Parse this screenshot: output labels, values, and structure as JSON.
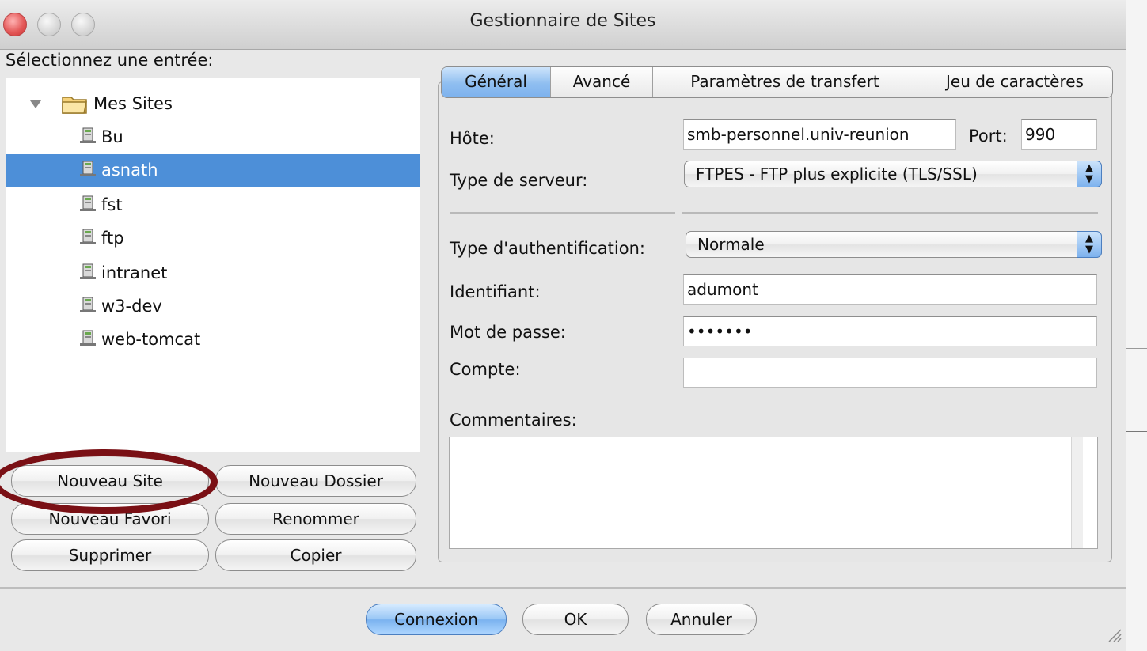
{
  "window": {
    "title": "Gestionnaire de Sites"
  },
  "left": {
    "select_label": "Sélectionnez une entrée:",
    "tree": {
      "root": "Mes Sites",
      "items": [
        "Bu",
        "asnath",
        "fst",
        "ftp",
        "intranet",
        "w3-dev",
        "web-tomcat"
      ],
      "selected": "asnath"
    },
    "buttons": {
      "new_site": "Nouveau Site",
      "new_folder": "Nouveau Dossier",
      "new_bookmark": "Nouveau Favori",
      "rename": "Renommer",
      "delete": "Supprimer",
      "copy": "Copier"
    }
  },
  "tabs": [
    {
      "label": "Général",
      "active": true
    },
    {
      "label": "Avancé",
      "active": false
    },
    {
      "label": "Paramètres de transfert",
      "active": false
    },
    {
      "label": "Jeu de caractères",
      "active": false
    }
  ],
  "general": {
    "host_label": "Hôte:",
    "host_value": "smb-personnel.univ-reunion",
    "port_label": "Port:",
    "port_value": "990",
    "server_type_label": "Type de serveur:",
    "server_type_value": "FTPES - FTP plus explicite (TLS/SSL)",
    "auth_type_label": "Type d'authentification:",
    "auth_type_value": "Normale",
    "user_label": "Identifiant:",
    "user_value": "adumont",
    "password_label": "Mot de passe:",
    "password_value": "•••••••",
    "account_label": "Compte:",
    "account_value": "",
    "comments_label": "Commentaires:"
  },
  "footer": {
    "connect": "Connexion",
    "ok": "OK",
    "cancel": "Annuler"
  },
  "colors": {
    "selection": "#4d8fd8",
    "highlight_ellipse": "#7a1015",
    "close_button": "#e45a5a"
  }
}
